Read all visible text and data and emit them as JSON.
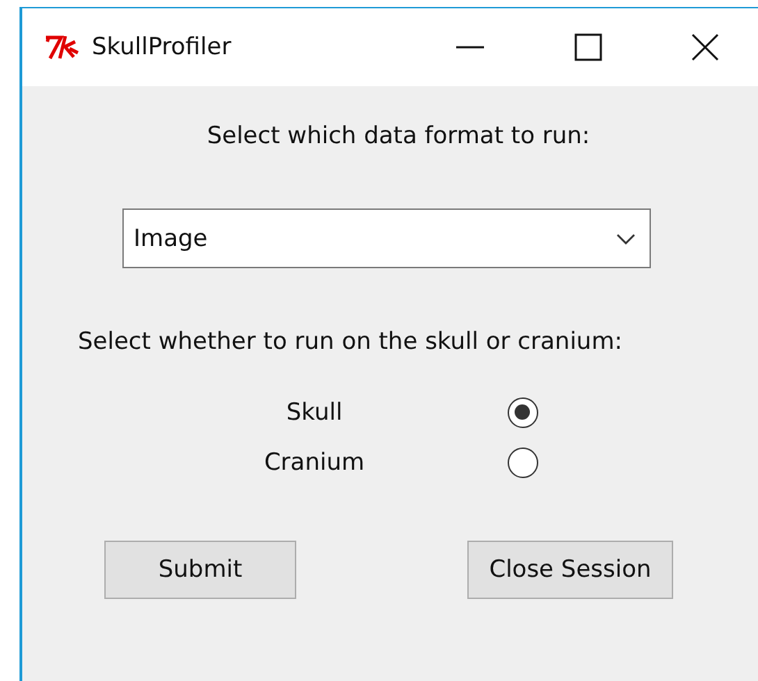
{
  "window": {
    "title": "SkullProfiler"
  },
  "format_prompt": "Select which data format to run:",
  "format_select": {
    "value": "Image"
  },
  "target_prompt": "Select whether to run on the skull or cranium:",
  "options": [
    {
      "label": "Skull",
      "selected": true
    },
    {
      "label": "Cranium",
      "selected": false
    }
  ],
  "buttons": [
    {
      "label": "Submit"
    },
    {
      "label": "Close Session"
    }
  ]
}
